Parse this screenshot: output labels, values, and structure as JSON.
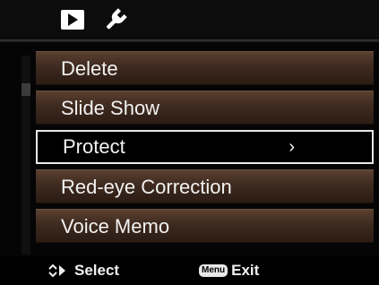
{
  "tabs": [
    {
      "icon": "playback-icon"
    },
    {
      "icon": "wrench-icon"
    }
  ],
  "menu": {
    "items": [
      {
        "label": "Delete"
      },
      {
        "label": "Slide Show"
      },
      {
        "label": "Protect",
        "arrow": "›"
      },
      {
        "label": "Red-eye Correction"
      },
      {
        "label": "Voice Memo"
      }
    ],
    "selected_index": 2
  },
  "footer": {
    "select_label": "Select",
    "menu_key": "Menu",
    "exit_label": "Exit"
  }
}
